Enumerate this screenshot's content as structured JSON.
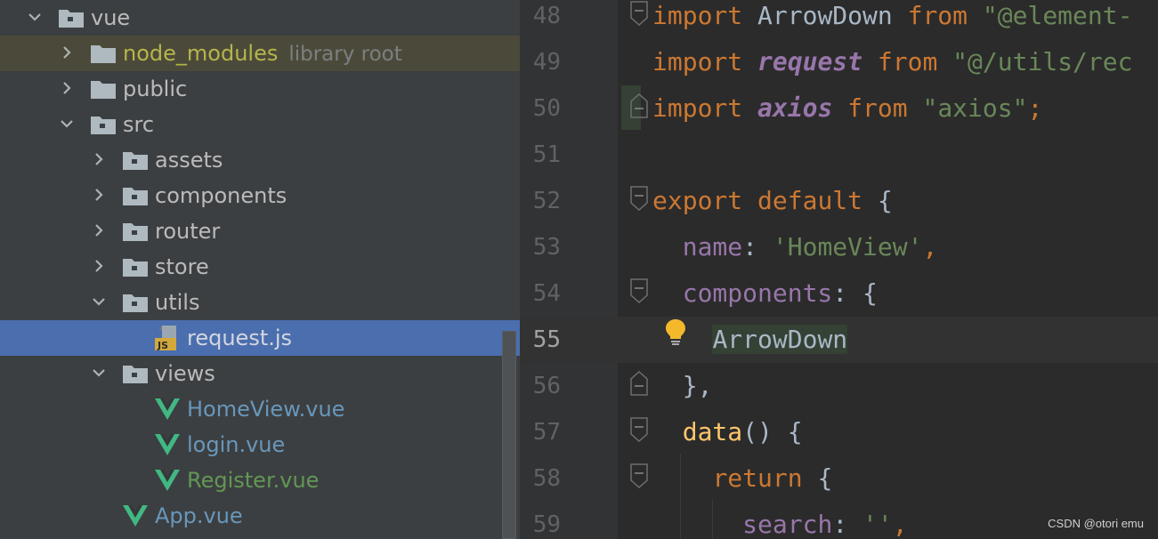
{
  "project_tree": {
    "items": [
      {
        "label": "vue",
        "sublabel": "",
        "kind": "folder",
        "expanded": true
      },
      {
        "label": "node_modules",
        "sublabel": "library root",
        "kind": "folder",
        "expanded": false
      },
      {
        "label": "public",
        "sublabel": "",
        "kind": "folder",
        "expanded": false
      },
      {
        "label": "src",
        "sublabel": "",
        "kind": "folder",
        "expanded": true
      },
      {
        "label": "assets",
        "sublabel": "",
        "kind": "folder",
        "expanded": false
      },
      {
        "label": "components",
        "sublabel": "",
        "kind": "folder",
        "expanded": false
      },
      {
        "label": "router",
        "sublabel": "",
        "kind": "folder",
        "expanded": false
      },
      {
        "label": "store",
        "sublabel": "",
        "kind": "folder",
        "expanded": false
      },
      {
        "label": "utils",
        "sublabel": "",
        "kind": "folder",
        "expanded": true
      },
      {
        "label": "request.js",
        "sublabel": "",
        "kind": "js-file",
        "selected": true
      },
      {
        "label": "views",
        "sublabel": "",
        "kind": "folder",
        "expanded": true
      },
      {
        "label": "HomeView.vue",
        "sublabel": "",
        "kind": "vue-file"
      },
      {
        "label": "login.vue",
        "sublabel": "",
        "kind": "vue-file"
      },
      {
        "label": "Register.vue",
        "sublabel": "",
        "kind": "vue-file"
      },
      {
        "label": "App.vue",
        "sublabel": "",
        "kind": "vue-file"
      }
    ],
    "js_badge": "JS"
  },
  "editor": {
    "lines": [
      {
        "num": "48",
        "t": [
          "import",
          " ArrowDown ",
          "from",
          " \"@element-"
        ]
      },
      {
        "num": "49",
        "t": [
          "import",
          " ",
          "request",
          " ",
          "from",
          " \"@/utils/rec"
        ]
      },
      {
        "num": "50",
        "t": [
          "import",
          " ",
          "axios",
          " ",
          "from",
          " \"axios\"",
          ";"
        ]
      },
      {
        "num": "51",
        "t": []
      },
      {
        "num": "52",
        "t": [
          "export",
          " ",
          "default",
          " {"
        ]
      },
      {
        "num": "53",
        "t": [
          "  ",
          "name",
          ": ",
          "'HomeView'",
          ","
        ]
      },
      {
        "num": "54",
        "t": [
          "  ",
          "components",
          ": {"
        ]
      },
      {
        "num": "55",
        "t": [
          "    ",
          "ArrowDown"
        ]
      },
      {
        "num": "56",
        "t": [
          "  },"
        ]
      },
      {
        "num": "57",
        "t": [
          "  ",
          "data",
          "() {"
        ]
      },
      {
        "num": "58",
        "t": [
          "    ",
          "return",
          " {"
        ]
      },
      {
        "num": "59",
        "t": [
          "      ",
          "search",
          ": ",
          "''",
          ","
        ]
      }
    ]
  },
  "watermark": "CSDN @otori emu",
  "colors": {
    "tree_bg": "#3c3f41",
    "selection": "#4b6eaf",
    "editor_bg": "#2b2b2b",
    "keyword": "#cc7832",
    "string": "#6a8759",
    "property": "#9876aa",
    "function": "#ffc66d"
  },
  "icons": [
    "chevron-right-icon",
    "chevron-down-icon",
    "folder-icon",
    "js-file-icon",
    "vue-file-icon",
    "fold-icon",
    "lightbulb-icon"
  ]
}
